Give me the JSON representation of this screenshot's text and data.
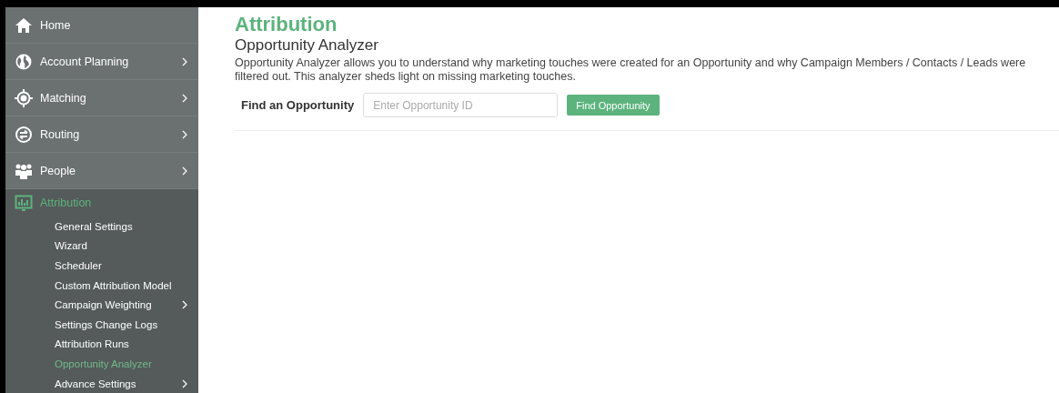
{
  "sidebar": {
    "items": [
      {
        "label": "Home",
        "kind": "home",
        "chevron": false,
        "expanded": false
      },
      {
        "label": "Account Planning",
        "kind": "globe",
        "chevron": true,
        "expanded": false
      },
      {
        "label": "Matching",
        "kind": "target",
        "chevron": true,
        "expanded": false
      },
      {
        "label": "Routing",
        "kind": "swap",
        "chevron": true,
        "expanded": false
      },
      {
        "label": "People",
        "kind": "people",
        "chevron": true,
        "expanded": false
      },
      {
        "label": "Attribution",
        "kind": "chart",
        "chevron": false,
        "expanded": true,
        "children": [
          {
            "label": "General Settings",
            "chevron": false,
            "selected": false
          },
          {
            "label": "Wizard",
            "chevron": false,
            "selected": false
          },
          {
            "label": "Scheduler",
            "chevron": false,
            "selected": false
          },
          {
            "label": "Custom Attribution Model",
            "chevron": false,
            "selected": false
          },
          {
            "label": "Campaign Weighting",
            "chevron": true,
            "selected": false
          },
          {
            "label": "Settings Change Logs",
            "chevron": false,
            "selected": false
          },
          {
            "label": "Attribution Runs",
            "chevron": false,
            "selected": false
          },
          {
            "label": "Opportunity Analyzer",
            "chevron": false,
            "selected": true
          },
          {
            "label": "Advance Settings",
            "chevron": true,
            "selected": false
          }
        ]
      }
    ]
  },
  "page": {
    "title": "Attribution",
    "subtitle": "Opportunity Analyzer",
    "description": "Opportunity Analyzer allows you to understand why marketing touches were created for an Opportunity and why Campaign Members / Contacts / Leads were filtered out. This analyzer sheds light on missing marketing touches.",
    "search": {
      "label": "Find an Opportunity",
      "placeholder": "Enter Opportunity ID",
      "button": "Find Opportunity"
    }
  }
}
